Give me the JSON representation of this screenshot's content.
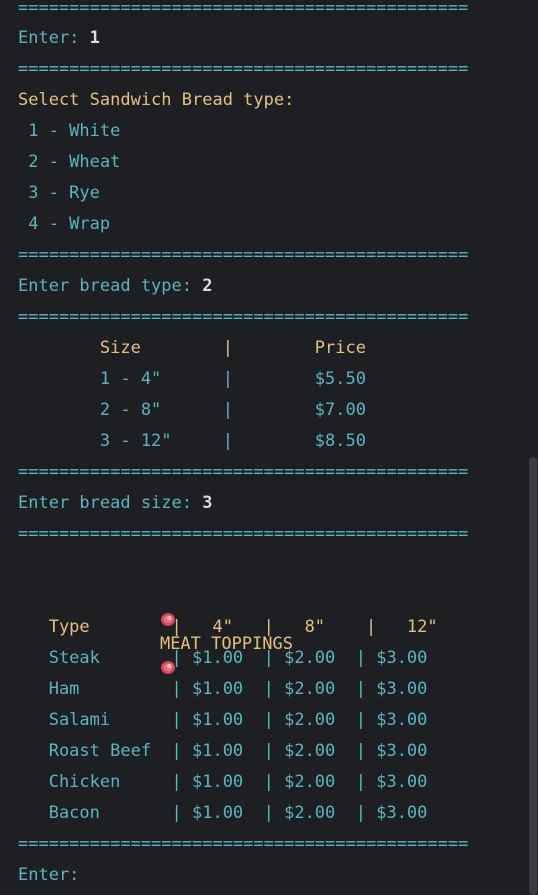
{
  "terminal": {
    "separator": "============================================",
    "prompt_choice": {
      "label": "Enter: ",
      "value": "1"
    },
    "bread_type": {
      "heading": "Select Sandwich Bread type:",
      "options": [
        " 1 - White",
        " 2 - Wheat",
        " 3 - Rye",
        " 4 - Wrap"
      ]
    },
    "prompt_bread_type": {
      "label": "Enter bread type: ",
      "value": "2"
    },
    "size_table": {
      "header": "        Size        |        Price",
      "rows": [
        "        1 - 4\"      |        $5.50",
        "        2 - 8\"      |        $7.00",
        "        3 - 12\"     |        $8.50"
      ]
    },
    "prompt_bread_size": {
      "label": "Enter bread size: ",
      "value": "3"
    },
    "meat_toppings": {
      "title": "MEAT TOPPINGS",
      "title_icon": "meat-icon",
      "header": "   Type        |   4\"   |   8\"    |   12\"",
      "rows": [
        "   Steak       | $1.00  | $2.00  | $3.00",
        "   Ham         | $1.00  | $2.00  | $3.00",
        "   Salami      | $1.00  | $2.00  | $3.00",
        "   Roast Beef  | $1.00  | $2.00  | $3.00",
        "   Chicken     | $1.00  | $2.00  | $3.00",
        "   Bacon       | $1.00  | $2.00  | $3.00"
      ]
    },
    "prompt_final": {
      "label": "Enter: "
    }
  },
  "colors": {
    "background": "#1e1f22",
    "text_cyan": "#56b6c2",
    "text_yellow": "#e5c07b",
    "input_white": "#dcdcdc"
  }
}
